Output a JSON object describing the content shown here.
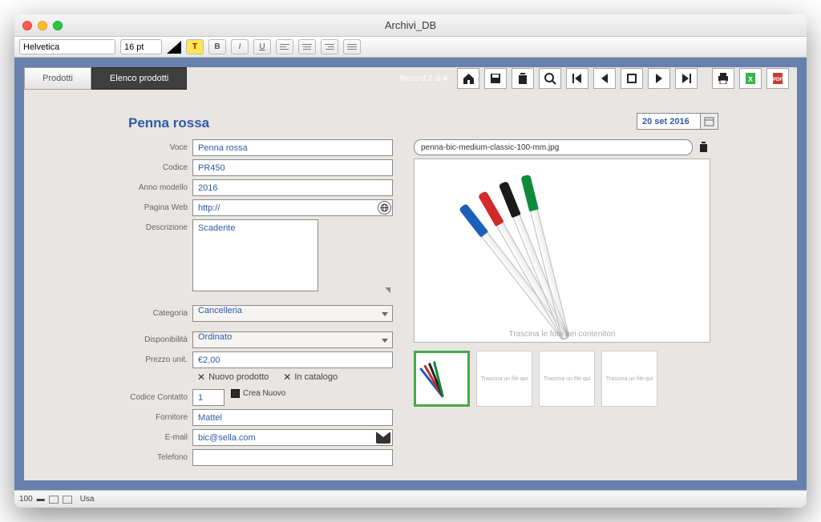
{
  "window": {
    "title": "Archivi_DB"
  },
  "formatbar": {
    "font": "Helvetica",
    "size": "16 pt"
  },
  "tabs": {
    "prodotti": "Prodotti",
    "elenco": "Elenco prodotti"
  },
  "record_nav": {
    "label_prefix": "Record 2 di ",
    "total": "4"
  },
  "page": {
    "title": "Penna rossa",
    "date": "20 set 2016"
  },
  "labels": {
    "voce": "Voce",
    "codice": "Codice",
    "anno": "Anno modello",
    "web": "Pagina Web",
    "descrizione": "Descrizione",
    "categoria": "Categoria",
    "disponibilita": "Disponibilità",
    "prezzo": "Prezzo unit.",
    "nuovo_prodotto": "Nuovo prodotto",
    "in_catalogo": "In catalogo",
    "codice_contatto": "Codice Contatto",
    "crea_nuovo": "Crea Nuovo",
    "fornitore": "Fornitore",
    "email": "E-mail",
    "telefono": "Telefono"
  },
  "values": {
    "voce": "Penna rossa",
    "codice": "PR450",
    "anno": "2016",
    "web": "http://",
    "descrizione": "Scadente",
    "categoria": "Cancelleria",
    "disponibilita": "Ordinato",
    "prezzo": "€2,00",
    "codice_contatto": "1",
    "fornitore": "Mattel",
    "email": "bic@sella.com",
    "telefono": ""
  },
  "image": {
    "filename": "penna-bic-medium-classic-100-mm.jpg",
    "drag_hint_main": "Trascina le foto nei contenitori",
    "drag_hint_thumb": "Trascina un file qui"
  },
  "statusbar": {
    "zoom": "100",
    "mode": "Usa"
  }
}
